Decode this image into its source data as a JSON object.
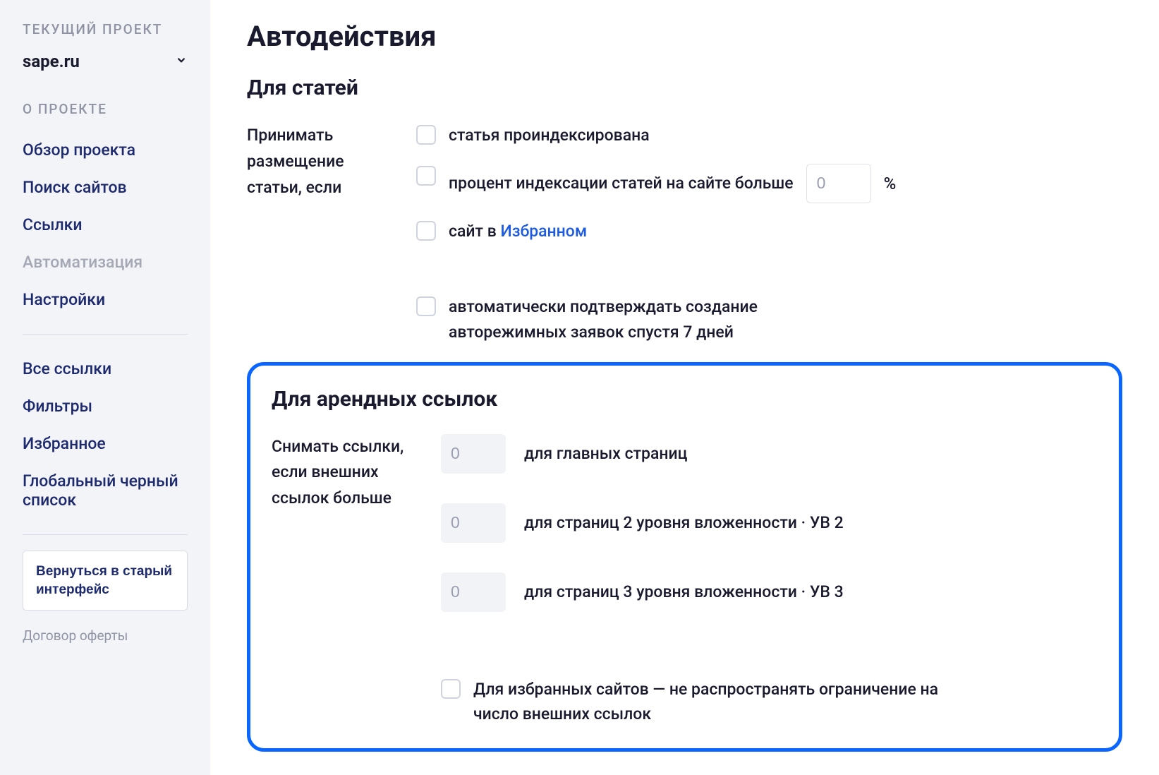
{
  "sidebar": {
    "section_label_current": "ТЕКУЩИЙ ПРОЕКТ",
    "project_name": "sape.ru",
    "section_label_about": "О ПРОЕКТЕ",
    "nav_about": [
      "Обзор проекта",
      "Поиск сайтов",
      "Ссылки",
      "Автоматизация",
      "Настройки"
    ],
    "nav_links": [
      "Все ссылки",
      "Фильтры",
      "Избранное",
      "Глобальный черный список"
    ],
    "legacy_button": "Вернуться в старый интерфейс",
    "footer_link": "Договор оферты"
  },
  "main": {
    "title": "Автодействия",
    "articles": {
      "heading": "Для статей",
      "accept_label": "Принимать размещение статьи, если",
      "check_indexed": "статья проиндексирована",
      "check_percent_prefix": "процент индексации статей на сайте больше",
      "percent_value": "0",
      "percent_sign": "%",
      "check_favorites_prefix": "сайт в ",
      "check_favorites_link": "Избранном",
      "check_autoconfirm": "автоматически подтверждать создание авторежимных заявок спустя 7 дней"
    },
    "rental": {
      "heading": "Для арендных ссылок",
      "remove_label": "Снимать ссылки, если внешних ссылок больше",
      "rows": [
        {
          "value": "0",
          "suffix": "для главных страниц"
        },
        {
          "value": "0",
          "suffix": "для страниц 2 уровня вложенности · УВ 2"
        },
        {
          "value": "0",
          "suffix": "для страниц 3 уровня вложенности · УВ 3"
        }
      ],
      "favorites_exempt": "Для избранных сайтов — не распространять ограничение на число внешних ссылок"
    }
  }
}
